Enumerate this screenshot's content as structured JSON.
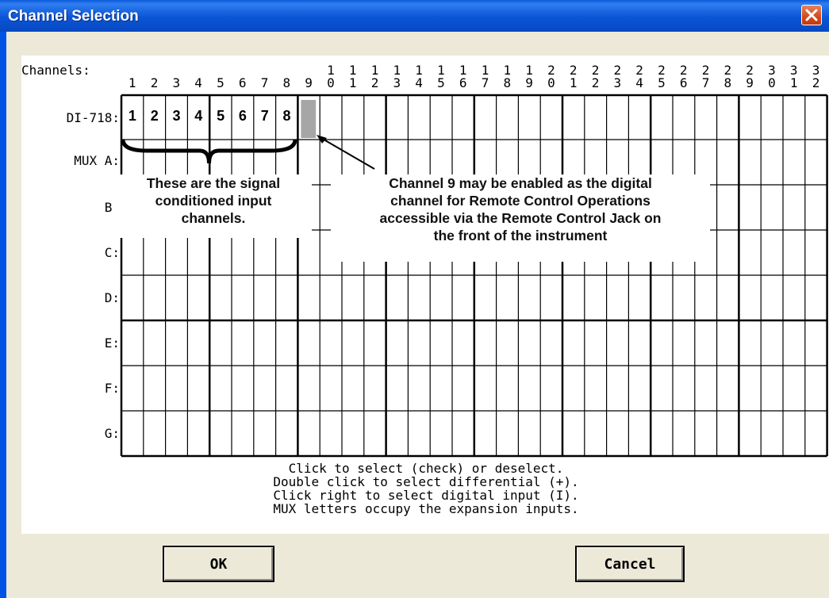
{
  "window": {
    "title": "Channel Selection"
  },
  "grid": {
    "channels_label": "Channels:",
    "channel_numbers": [
      "1",
      "2",
      "3",
      "4",
      "5",
      "6",
      "7",
      "8",
      "9",
      "10",
      "11",
      "12",
      "13",
      "14",
      "15",
      "16",
      "17",
      "18",
      "19",
      "20",
      "21",
      "22",
      "23",
      "24",
      "25",
      "26",
      "27",
      "28",
      "29",
      "30",
      "31",
      "32"
    ],
    "row_labels": [
      "DI-718:",
      "MUX A:",
      "B:",
      "C:",
      "D:",
      "E:",
      "F:",
      "G:"
    ],
    "di718_cells": [
      "1",
      "2",
      "3",
      "4",
      "5",
      "6",
      "7",
      "8"
    ]
  },
  "annotations": {
    "signal_conditioned": "These are the signal\nconditioned input\nchannels.",
    "channel9": "Channel 9 may be enabled as the digital\nchannel for Remote Control Operations\naccessible via the Remote Control Jack on\nthe front of the instrument"
  },
  "instructions": "Click to select (check) or deselect.\nDouble click to select differential (+).\nClick right to select digital input (I).\nMUX letters occupy the expansion inputs.",
  "buttons": {
    "ok": "OK",
    "cancel": "Cancel"
  },
  "colors": {
    "title_bar": "#0a55d6",
    "dialog_bg": "#ece9d8",
    "close_button": "#d14a1f",
    "channel9_cell": "#a6a6a6"
  }
}
